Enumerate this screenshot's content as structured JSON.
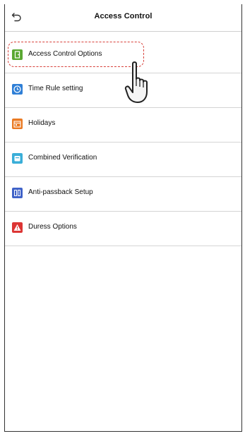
{
  "header": {
    "title": "Access Control",
    "back_icon": "back-arrow-icon"
  },
  "menu": {
    "items": [
      {
        "label": "Access Control Options",
        "icon": "access-options-icon",
        "color": "#5aa832"
      },
      {
        "label": "Time Rule setting",
        "icon": "clock-icon",
        "color": "#2f7fd6"
      },
      {
        "label": "Holidays",
        "icon": "calendar-icon",
        "color": "#ea7a23"
      },
      {
        "label": "Combined Verification",
        "icon": "group-verify-icon",
        "color": "#3aaed8"
      },
      {
        "label": "Anti-passback Setup",
        "icon": "anti-passback-icon",
        "color": "#3f62c8"
      },
      {
        "label": "Duress Options",
        "icon": "warning-icon",
        "color": "#dc3534"
      }
    ]
  },
  "annotation": {
    "highlight_color": "#d8403a",
    "pointer_icon": "pointing-hand-icon"
  }
}
